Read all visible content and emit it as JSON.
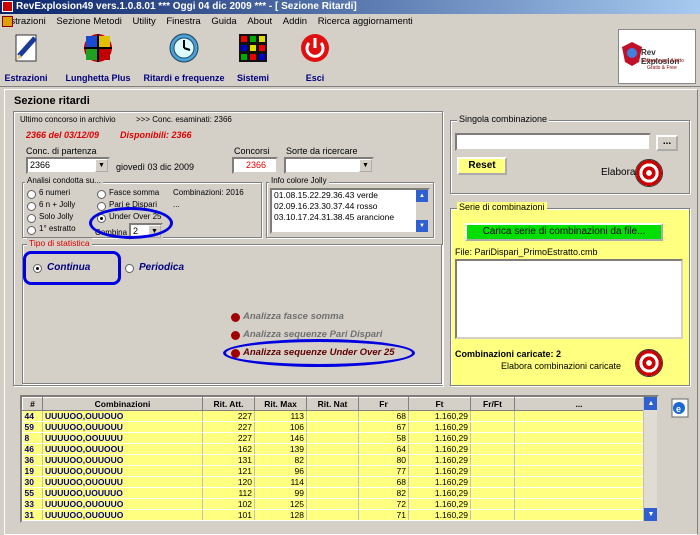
{
  "titlebar": {
    "title": "RevExplosion49 vers.1.0.8.01  ***  Oggi 04 dic 2009   ***   - [ Sezione Ritardi]"
  },
  "menu": [
    "Estrazioni",
    "Sezione Metodi",
    "Utility",
    "Finestra",
    "Guida",
    "About",
    "Addin",
    "Ricerca aggiornamenti"
  ],
  "toolbar": {
    "items": [
      "Estrazioni",
      "Lunghetta Plus",
      "Ritardi e frequenze",
      "Sistemi",
      "Esci"
    ]
  },
  "logo": {
    "l1": "Rev Explosion",
    "l2": "Software per il lotto",
    "l3": "Gratis & Free"
  },
  "section": {
    "title": "Sezione ritardi"
  },
  "archive": {
    "last_label": "Ultimo concorso in archivio",
    "examined": ">>> Conc. esaminati: 2366",
    "last_value": "2366 del 03/12/09",
    "available": "Disponibili: 2366"
  },
  "conc": {
    "label": "Conc. di partenza",
    "value": "2366",
    "date": "giovedì 03 dic 2009",
    "concorsi_label": "Concorsi",
    "concorsi_value": "2366",
    "sorte_label": "Sorte da ricercare",
    "sorte_value": ""
  },
  "analisi": {
    "title": "Analisi condotta su...",
    "opts_left": [
      "6 numeri",
      "6 n + Jolly",
      "Solo Jolly",
      "1° estratto"
    ],
    "opts_right": [
      "Fasce somma",
      "Pari e Dispari",
      "Under Over 25"
    ],
    "combinazioni": "Combinazioni: 2016",
    "ellipsis": "...",
    "combina_label": "Combina",
    "combina_value": "2"
  },
  "jolly": {
    "title": "Info colore Jolly",
    "lines": [
      "01.08.15.22.29.36.43 verde",
      "02.09.16.23.30.37.44 rosso",
      "03.10.17.24.31.38.45 arancione"
    ]
  },
  "tipo": {
    "title": "Tipo di statistica",
    "continua": "Continua",
    "periodica": "Periodica"
  },
  "actions": {
    "a1": "Analizza fasce somma",
    "a2": "Analizza sequenze Pari Dispari",
    "a3": "Analizza sequenze Under Over 25"
  },
  "singola": {
    "title": "Singola combinazione",
    "reset": "Reset",
    "elabora": "Elabora",
    "btn": "..."
  },
  "serie": {
    "title": "Serie di combinazioni",
    "load": "Carica serie di combinazioni da file...",
    "file": "File: PariDispari_PrimoEstratto.cmb",
    "caricate": "Combinazioni caricate: 2",
    "elabora": "Elabora combinazioni caricate"
  },
  "grid": {
    "headers": [
      "#",
      "Combinazioni",
      "Rit. Att.",
      "Rit. Max",
      "Rit. Nat",
      "Fr",
      "Ft",
      "Fr/Ft",
      "..."
    ],
    "rows": [
      [
        "44",
        "UUUUOO,OUUOUO",
        "227",
        "113",
        "",
        "68",
        "1.160,29",
        "",
        ""
      ],
      [
        "59",
        "UUUUOO,OUUOUU",
        "227",
        "106",
        "",
        "67",
        "1.160,29",
        "",
        ""
      ],
      [
        "8",
        "UUUUOO,OOUUUU",
        "227",
        "146",
        "",
        "58",
        "1.160,29",
        "",
        ""
      ],
      [
        "46",
        "UUUUOO,OUUOOU",
        "162",
        "139",
        "",
        "64",
        "1.160,29",
        "",
        ""
      ],
      [
        "36",
        "UUUUOO,OUUOUO",
        "131",
        "82",
        "",
        "80",
        "1.160,29",
        "",
        ""
      ],
      [
        "19",
        "UUUUOO,OUUOUU",
        "121",
        "96",
        "",
        "77",
        "1.160,29",
        "",
        ""
      ],
      [
        "30",
        "UUUUOO,OUOUUU",
        "120",
        "114",
        "",
        "68",
        "1.160,29",
        "",
        ""
      ],
      [
        "55",
        "UUUUOO,UOUUUO",
        "112",
        "99",
        "",
        "82",
        "1.160,29",
        "",
        ""
      ],
      [
        "33",
        "UUUUOO,OUOUUO",
        "102",
        "125",
        "",
        "72",
        "1.160,29",
        "",
        ""
      ],
      [
        "31",
        "UUUUOO,OUOUUO",
        "101",
        "128",
        "",
        "71",
        "1.160,29",
        "",
        ""
      ]
    ]
  }
}
